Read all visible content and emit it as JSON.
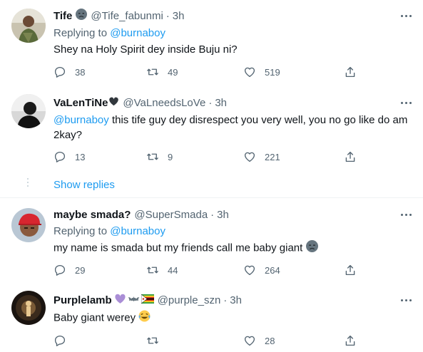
{
  "tweets": [
    {
      "name": "Tife",
      "handle": "@Tife_fabunmi",
      "dot": "·",
      "time": "3h",
      "replying_prefix": "Replying to ",
      "replying_to": "@burnaboy",
      "text": "Shey na Holy Spirit dey inside Buju ni?",
      "replies": "38",
      "retweets": "49",
      "likes": "519"
    },
    {
      "name": "VaLenTiNe",
      "handle": "@VaLneedsLoVe",
      "dot": "·",
      "time": "3h",
      "mention": "@burnaboy",
      "text": " this tife guy dey disrespect you very well, you no go like do am 2kay?",
      "replies": "13",
      "retweets": "9",
      "likes": "221"
    },
    {
      "name": "maybe smada?",
      "handle": "@SuperSmada",
      "dot": "·",
      "time": "3h",
      "replying_prefix": "Replying to ",
      "replying_to": "@burnaboy",
      "text": "my name is smada but my friends call me baby giant",
      "replies": "29",
      "retweets": "44",
      "likes": "264"
    },
    {
      "name": "Purplelamb",
      "handle": "@purple_szn",
      "dot": "·",
      "time": "3h",
      "text": "Baby giant werey",
      "likes": "28"
    }
  ],
  "show_replies": "Show replies",
  "colors": {
    "link": "#1d9bf0",
    "secondary": "#536471",
    "primary": "#0f1419",
    "divider": "#eff3f4"
  },
  "icons": [
    "more-icon",
    "reply-icon",
    "retweet-icon",
    "like-icon",
    "share-icon",
    "black-heart-emoji",
    "purple-heart-emoji",
    "bat-emoji",
    "zimbabwe-flag-emoji",
    "angry-face-emoji",
    "laughing-tears-emoji"
  ]
}
